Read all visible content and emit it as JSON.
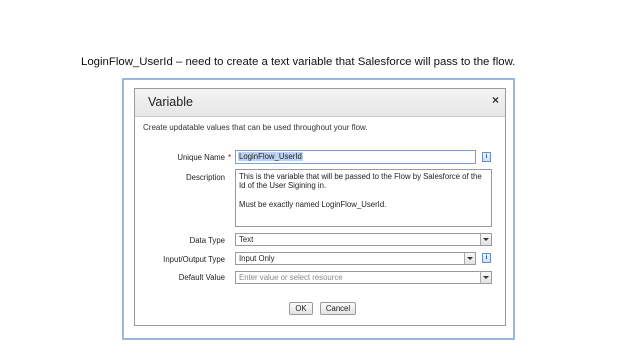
{
  "caption": "LoginFlow_UserId – need to create a text variable that Salesforce will pass to the flow.",
  "dialog": {
    "title": "Variable",
    "close_label": "×",
    "subtitle": "Create updatable values that can be used throughout your flow."
  },
  "form": {
    "unique_name": {
      "label": "Unique Name",
      "required_marker": "*",
      "value": "LoginFlow_UserId"
    },
    "description": {
      "label": "Description",
      "line1": "This is the variable that will be passed to the Flow by Salesforce of the Id of the User Sigining in.",
      "line2": "Must be exactly named LoginFlow_UserId."
    },
    "data_type": {
      "label": "Data Type",
      "value": "Text"
    },
    "io_type": {
      "label": "Input/Output Type",
      "value": "Input Only"
    },
    "default_value": {
      "label": "Default Value",
      "placeholder": "Enter value or select resource"
    }
  },
  "icons": {
    "info": "info-icon",
    "close": "close-icon",
    "dropdown": "chevron-down-icon"
  },
  "buttons": {
    "ok": "OK",
    "cancel": "Cancel"
  }
}
